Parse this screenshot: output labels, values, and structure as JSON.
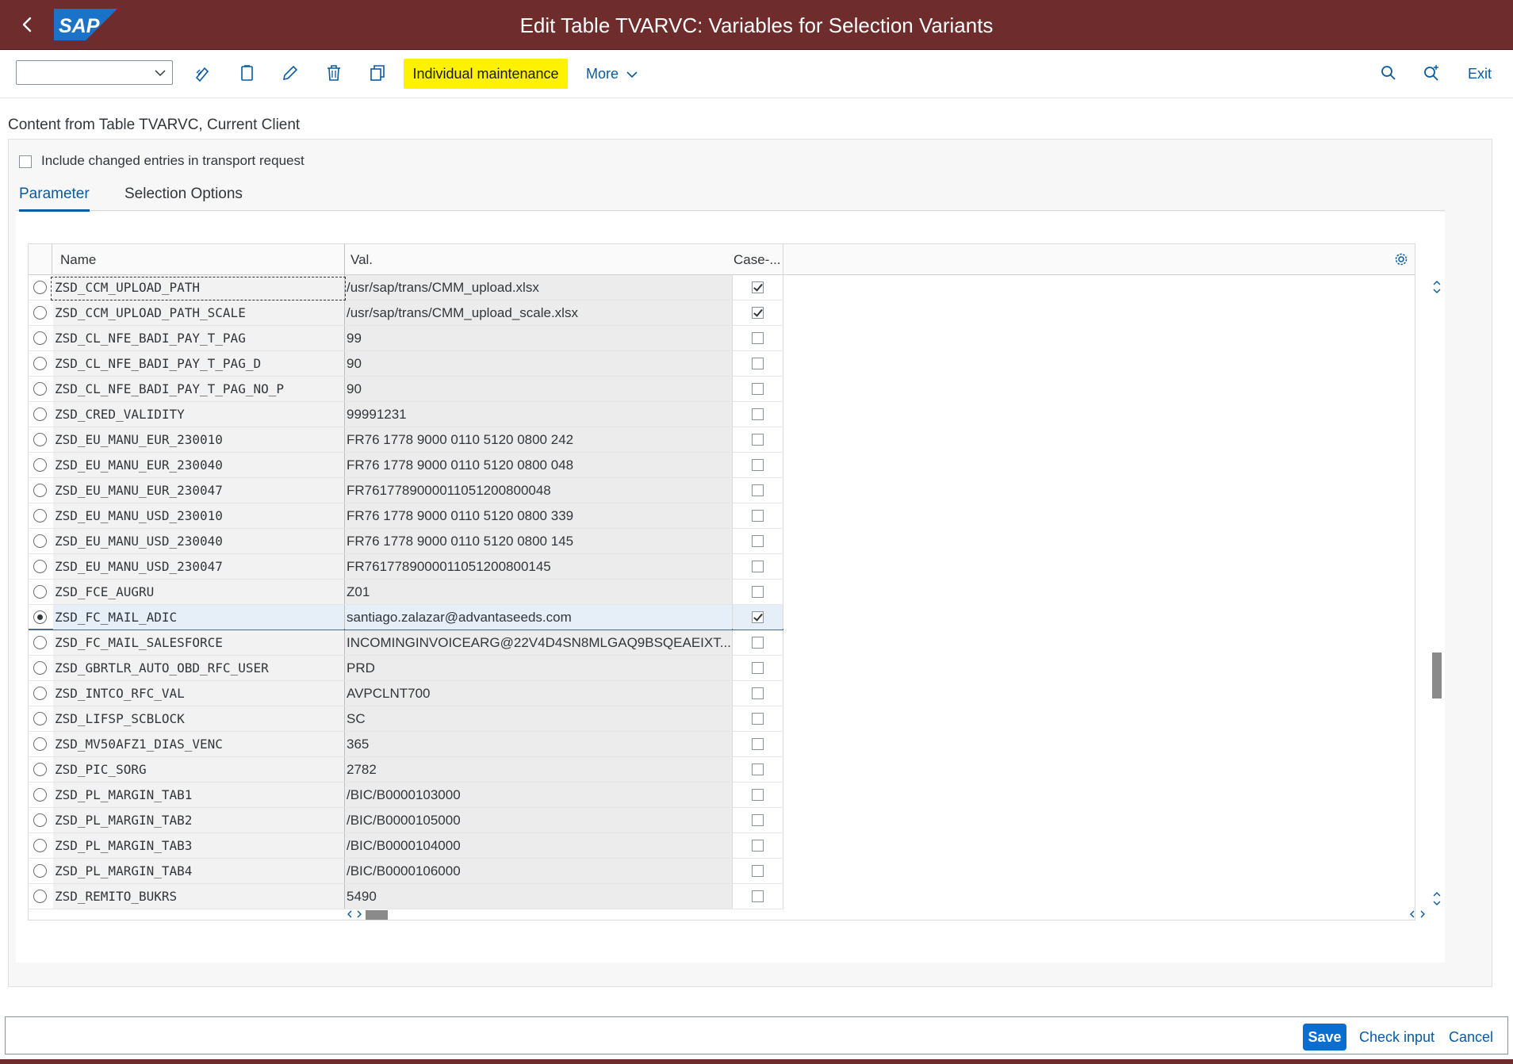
{
  "shell": {
    "title": "Edit Table TVARVC: Variables for Selection Variants",
    "logo_text": "SAP"
  },
  "toolbar": {
    "combo_value": "",
    "individual_maintenance": "Individual maintenance",
    "more": "More",
    "exit": "Exit",
    "icons": [
      "back-icon",
      "change-display-icon",
      "copy-icon",
      "edit-icon",
      "delete-icon",
      "duplicate-icon",
      "search-icon",
      "search-next-icon"
    ]
  },
  "content": {
    "title": "Content from Table TVARVC, Current Client",
    "include_changed": "Include changed entries in transport request",
    "tabs": [
      "Parameter",
      "Selection Options"
    ]
  },
  "table": {
    "headers": {
      "name": "Name",
      "value": "Val.",
      "case": "Case-..."
    },
    "rows": [
      {
        "name": "ZSD_CCM_UPLOAD_PATH",
        "value": "/usr/sap/trans/CMM_upload.xlsx",
        "case": true
      },
      {
        "name": "ZSD_CCM_UPLOAD_PATH_SCALE",
        "value": "/usr/sap/trans/CMM_upload_scale.xlsx",
        "case": true
      },
      {
        "name": "ZSD_CL_NFE_BADI_PAY_T_PAG",
        "value": "99",
        "case": false
      },
      {
        "name": "ZSD_CL_NFE_BADI_PAY_T_PAG_D",
        "value": "90",
        "case": false
      },
      {
        "name": "ZSD_CL_NFE_BADI_PAY_T_PAG_NO_P",
        "value": "90",
        "case": false
      },
      {
        "name": "ZSD_CRED_VALIDITY",
        "value": "99991231",
        "case": false
      },
      {
        "name": "ZSD_EU_MANU_EUR_230010",
        "value": "FR76 1778 9000 0110 5120 0800 242",
        "case": false
      },
      {
        "name": "ZSD_EU_MANU_EUR_230040",
        "value": "FR76 1778 9000 0110 5120 0800 048",
        "case": false
      },
      {
        "name": "ZSD_EU_MANU_EUR_230047",
        "value": "FR7617789000011051200800048",
        "case": false
      },
      {
        "name": "ZSD_EU_MANU_USD_230010",
        "value": "FR76 1778 9000 0110 5120 0800 339",
        "case": false
      },
      {
        "name": "ZSD_EU_MANU_USD_230040",
        "value": "FR76 1778 9000 0110 5120 0800 145",
        "case": false
      },
      {
        "name": "ZSD_EU_MANU_USD_230047",
        "value": "FR7617789000011051200800145",
        "case": false
      },
      {
        "name": "ZSD_FCE_AUGRU",
        "value": "Z01",
        "case": false
      },
      {
        "name": "ZSD_FC_MAIL_ADIC",
        "value": "santiago.zalazar@advantaseeds.com",
        "case": true,
        "selected": true
      },
      {
        "name": "ZSD_FC_MAIL_SALESFORCE",
        "value": "INCOMINGINVOICEARG@22V4D4SN8MLGAQ9BSQEAEIXT...",
        "case": false
      },
      {
        "name": "ZSD_GBRTLR_AUTO_OBD_RFC_USER",
        "value": "PRD",
        "case": false
      },
      {
        "name": "ZSD_INTCO_RFC_VAL",
        "value": "AVPCLNT700",
        "case": false
      },
      {
        "name": "ZSD_LIFSP_SCBLOCK",
        "value": "SC",
        "case": false
      },
      {
        "name": "ZSD_MV50AFZ1_DIAS_VENC",
        "value": "365",
        "case": false
      },
      {
        "name": "ZSD_PIC_SORG",
        "value": "2782",
        "case": false
      },
      {
        "name": "ZSD_PL_MARGIN_TAB1",
        "value": "/BIC/B0000103000",
        "case": false
      },
      {
        "name": "ZSD_PL_MARGIN_TAB2",
        "value": "/BIC/B0000105000",
        "case": false
      },
      {
        "name": "ZSD_PL_MARGIN_TAB3",
        "value": "/BIC/B0000104000",
        "case": false
      },
      {
        "name": "ZSD_PL_MARGIN_TAB4",
        "value": "/BIC/B0000106000",
        "case": false
      },
      {
        "name": "ZSD_REMITO_BUKRS",
        "value": "5490",
        "case": false
      }
    ]
  },
  "footer": {
    "save": "Save",
    "check_input": "Check input",
    "cancel": "Cancel"
  },
  "colors": {
    "shell": "#6e2c2c",
    "accent": "#0a6ed1",
    "highlight": "#fff200"
  }
}
